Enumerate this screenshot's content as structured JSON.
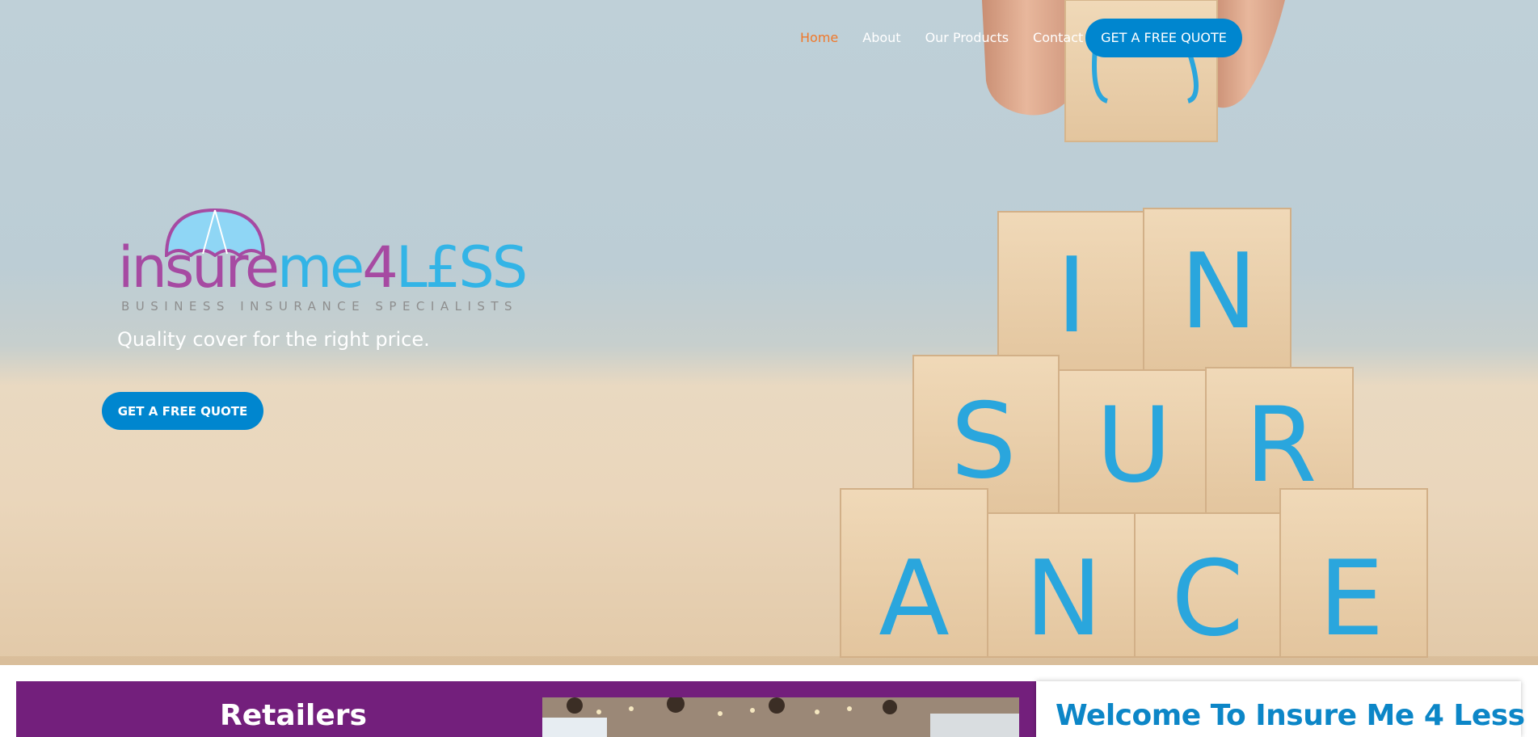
{
  "nav": {
    "items": [
      {
        "label": "Home",
        "active": true
      },
      {
        "label": "About",
        "active": false
      },
      {
        "label": "Our Products",
        "active": false
      },
      {
        "label": "Contact",
        "active": false
      }
    ],
    "cta_label": "GET A FREE QUOTE"
  },
  "logo": {
    "word_insure": "insure",
    "word_me": "me",
    "word_4": "4",
    "word_less": "L£SS",
    "subtitle": "BUSINESS INSURANCE SPECIALISTS"
  },
  "hero": {
    "tagline": "Quality cover for the right price.",
    "cta_label": "GET A FREE QUOTE",
    "blocks_letters": [
      "I",
      "N",
      "S",
      "U",
      "R",
      "A",
      "N",
      "C",
      "E"
    ]
  },
  "sections": {
    "retailers_title": "Retailers",
    "welcome_title": "Welcome To Insure Me 4 Less"
  },
  "colors": {
    "brand_blue": "#0086cf",
    "brand_purple": "#731f7c",
    "logo_purple": "#a64aa2",
    "logo_blue": "#33b4e6",
    "nav_active": "#f0782a",
    "block_letter": "#2aa6dd"
  }
}
